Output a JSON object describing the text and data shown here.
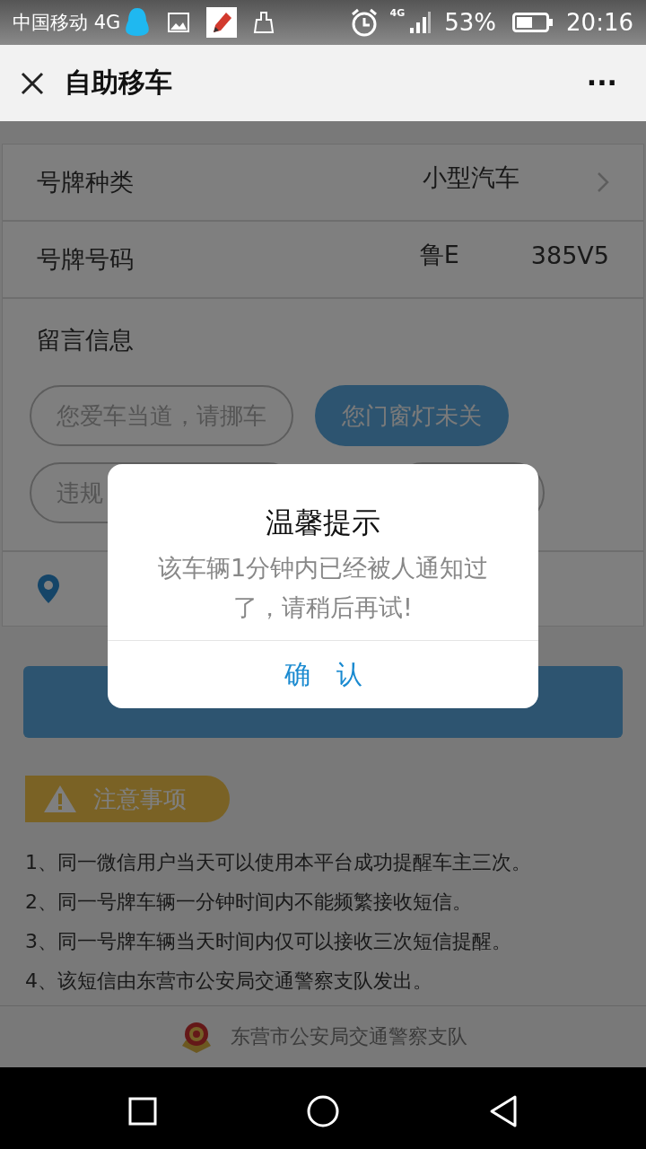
{
  "status_bar": {
    "carrier": "中国移动 4G",
    "network": "4G",
    "battery": "53%",
    "time": "20:16"
  },
  "header": {
    "title": "自助移车",
    "more": "···"
  },
  "form": {
    "plate_type": {
      "label": "号牌种类",
      "value": "小型汽车"
    },
    "plate_number": {
      "label": "号牌号码",
      "prefix": "鲁E",
      "value": "385V5"
    },
    "message": {
      "label": "留言信息",
      "chips": [
        {
          "text": "您爱车当道，请挪车",
          "selected": false
        },
        {
          "text": "您门窗灯未关",
          "selected": true
        },
        {
          "text": "违规",
          "selected": false
        },
        {
          "selected": false
        }
      ]
    }
  },
  "notice": {
    "title": "注意事项",
    "items": [
      "1、同一微信用户当天可以使用本平台成功提醒车主三次。",
      "2、同一号牌车辆一分钟时间内不能频繁接收短信。",
      "3、同一号牌车辆当天时间内仅可以接收三次短信提醒。",
      "4、该短信由东营市公安局交通警察支队发出。"
    ]
  },
  "footer": {
    "text": "东营市公安局交通警察支队"
  },
  "dialog": {
    "title": "温馨提示",
    "message": "该车辆1分钟内已经被人通知过了，请稍后再试!",
    "button": "确　认"
  }
}
